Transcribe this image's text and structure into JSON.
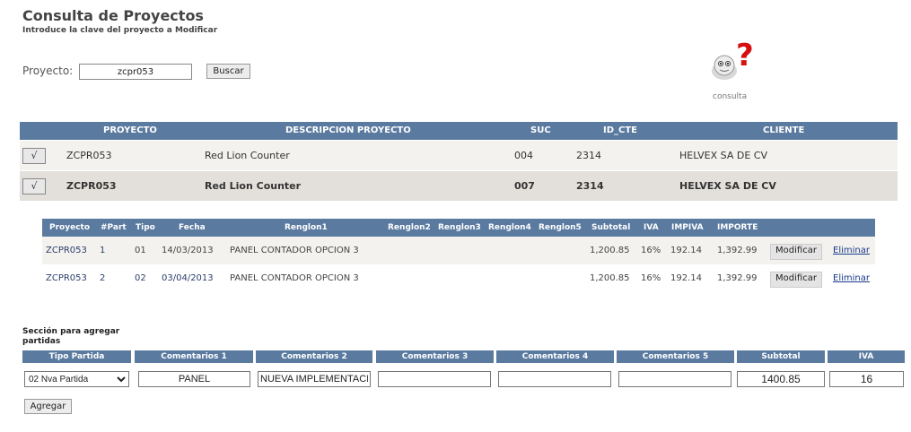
{
  "header": {
    "title": "Consulta de Proyectos",
    "subtitle": "Introduce la clave del proyecto a Modificar"
  },
  "search": {
    "label": "Proyecto:",
    "value": "zcpr053",
    "button": "Buscar"
  },
  "help": {
    "label": "consulta",
    "icon": "question-person-icon"
  },
  "projects": {
    "columns": [
      "PROYECTO",
      "DESCRIPCION PROYECTO",
      "SUC",
      "ID_CTE",
      "CLIENTE"
    ],
    "check_symbol": "√",
    "rows": [
      {
        "proyecto": "ZCPR053",
        "descripcion": "Red Lion Counter",
        "suc": "004",
        "id_cte": "2314",
        "cliente": "HELVEX SA DE CV"
      },
      {
        "proyecto": "ZCPR053",
        "descripcion": "Red Lion Counter",
        "suc": "007",
        "id_cte": "2314",
        "cliente": "HELVEX SA DE CV"
      }
    ]
  },
  "partidas": {
    "columns": [
      "Proyecto",
      "#Part",
      "Tipo",
      "Fecha",
      "Renglon1",
      "Renglon2",
      "Renglon3",
      "Renglon4",
      "Renglon5",
      "Subtotal",
      "IVA",
      "IMPIVA",
      "IMPORTE"
    ],
    "modify_label": "Modificar",
    "delete_label": "Eliminar",
    "rows": [
      {
        "proyecto": "ZCPR053",
        "part": "1",
        "tipo": "01",
        "fecha": "14/03/2013",
        "renglon1": "PANEL CONTADOR OPCION 3",
        "subtotal": "1,200.85",
        "iva": "16%",
        "impiva": "192.14",
        "importe": "1,392.99"
      },
      {
        "proyecto": "ZCPR053",
        "part": "2",
        "tipo": "02",
        "fecha": "03/04/2013",
        "renglon1": "PANEL CONTADOR OPCION 3",
        "subtotal": "1,200.85",
        "iva": "16%",
        "impiva": "192.14",
        "importe": "1,392.99"
      }
    ]
  },
  "add_section": {
    "title": "Sección para agregar partidas",
    "columns": [
      "Tipo Partida",
      "Comentarios 1",
      "Comentarios 2",
      "Comentarios 3",
      "Comentarios 4",
      "Comentarios 5",
      "Subtotal",
      "IVA"
    ],
    "tipo_selected": "02 Nva Partida",
    "comentarios1": "PANEL",
    "comentarios2": "NUEVA IMPLEMENTACION",
    "comentarios3": "",
    "comentarios4": "",
    "comentarios5": "",
    "subtotal": "1400.85",
    "iva": "16",
    "button": "Agregar"
  },
  "colors": {
    "header_bg": "#5a7aa0",
    "row_alt": "#f4f2ee",
    "row_selected": "#e3e0db"
  }
}
